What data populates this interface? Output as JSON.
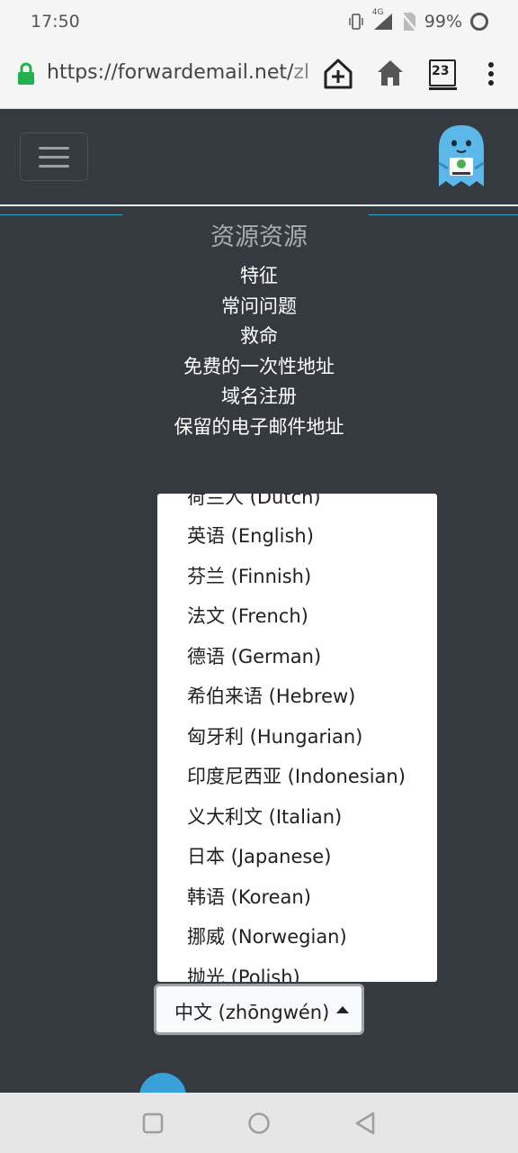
{
  "status_bar": {
    "time": "17:50",
    "network": "4G",
    "battery": "99%",
    "icons": [
      "vibrate-icon",
      "signal-icon",
      "no-sim-icon",
      "battery-ring-icon"
    ]
  },
  "browser": {
    "url_main": "https://forwardemail.net/",
    "url_faded": "zh",
    "tab_count": "23"
  },
  "navbar": {
    "menu_icon": "hamburger-icon",
    "logo": "forward-email-mascot"
  },
  "resources": {
    "title": "资源资源",
    "links": [
      "特征",
      "常问问题",
      "救命",
      "免费的一次性地址",
      "域名注册",
      "保留的电子邮件地址"
    ]
  },
  "language_dropdown": {
    "options": [
      "荷兰人 (Dutch)",
      "英语 (English)",
      "芬兰 (Finnish)",
      "法文 (French)",
      "德语 (German)",
      "希伯来语 (Hebrew)",
      "匈牙利 (Hungarian)",
      "印度尼西亚 (Indonesian)",
      "义大利文 (Italian)",
      "日本 (Japanese)",
      "韩语 (Korean)",
      "挪威 (Norwegian)",
      "抛光 (Polish)"
    ],
    "selected": "中文 (zhōngwén)"
  },
  "colors": {
    "page_bg": "#343a40",
    "accent": "#3aa0d8",
    "lock": "#22b14c"
  }
}
